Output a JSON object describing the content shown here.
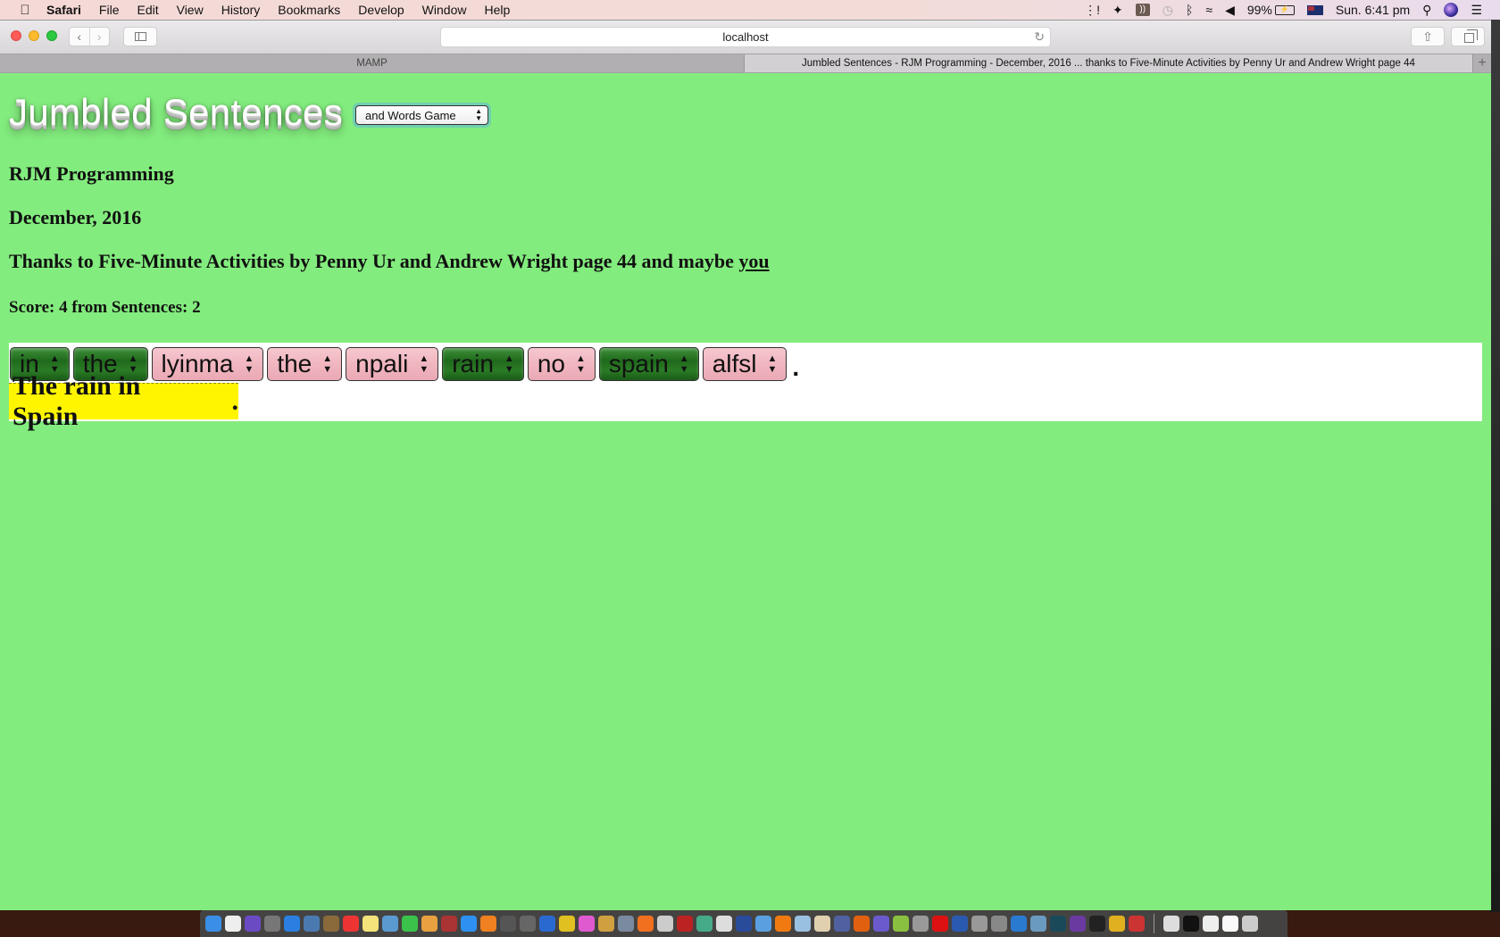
{
  "menubar": {
    "apple_icon": "apple-icon",
    "app_name": "Safari",
    "menus": [
      "File",
      "Edit",
      "View",
      "History",
      "Bookmarks",
      "Develop",
      "Window",
      "Help"
    ],
    "battery": "99%",
    "clock": "Sun. 6:41 pm",
    "status_icons": [
      "activity-icon",
      "avast-icon",
      "audio-icon",
      "time-machine-icon",
      "bluetooth-icon",
      "wifi-icon",
      "volume-icon",
      "battery-icon",
      "flag-icon",
      "spotlight-icon",
      "siri-icon",
      "notification-center-icon"
    ]
  },
  "browser": {
    "url": "localhost",
    "tabs": [
      {
        "label": "MAMP",
        "active": false
      },
      {
        "label": "Jumbled Sentences - RJM Programming - December, 2016 ... thanks to Five-Minute Activities by Penny Ur and Andrew Wright page 44",
        "active": true
      }
    ],
    "new_tab_label": "+"
  },
  "page": {
    "title": "Jumbled Sentences",
    "mode_select": {
      "value": "and Words Game"
    },
    "author": "RJM Programming",
    "date": "December, 2016",
    "thanks_prefix": "Thanks to Five-Minute Activities by Penny Ur and Andrew Wright page 44 and maybe ",
    "thanks_link": "you",
    "score": "Score: 4 from Sentences: 2",
    "colors": {
      "background": "#83ec7e",
      "correct": "#2b7c26",
      "wrong": "#f0b6c0",
      "answer_highlight": "#fff500"
    },
    "words": [
      {
        "value": "in",
        "state": "correct"
      },
      {
        "value": "the",
        "state": "correct"
      },
      {
        "value": "lyinma",
        "state": "wrong"
      },
      {
        "value": "the",
        "state": "wrong"
      },
      {
        "value": "npali",
        "state": "wrong"
      },
      {
        "value": "rain",
        "state": "correct"
      },
      {
        "value": "no",
        "state": "wrong"
      },
      {
        "value": "spain",
        "state": "correct"
      },
      {
        "value": "alfsl",
        "state": "wrong"
      }
    ],
    "sentence_end": ".",
    "answer": {
      "text": "The rain in Spain",
      "end": "."
    }
  },
  "dock": {
    "apps": [
      "Finder",
      "Document",
      "Siri",
      "Launchpad",
      "Safari",
      "Preview",
      "Notes Book",
      "Calendar",
      "Notes",
      "Image Capture",
      "FaceTime",
      "Photos",
      "Photo Booth",
      "App Store",
      "iBooks",
      "System Preferences",
      "Grab",
      "Xcode",
      "Wunderlist",
      "iTunes",
      "Paintbrush",
      "Image Viewer",
      "Avast",
      "Utility",
      "FileZilla",
      "Chrome",
      "Gimp",
      "QuickTime",
      "Screen Sharing",
      "VLC",
      "Cube",
      "TextEdit",
      "VirtualBox",
      "Firefox",
      "PhpStorm",
      "Android Studio",
      "Unknown",
      "Opera",
      "Vuze",
      "Unknown",
      "Keychain",
      "VS Code",
      "Photos Export",
      "Dots",
      "GitHub",
      "Terminal",
      "Keys",
      "Games",
      "Window 1",
      "Window 2",
      "Window 3",
      "Window 4",
      "Trash"
    ]
  }
}
